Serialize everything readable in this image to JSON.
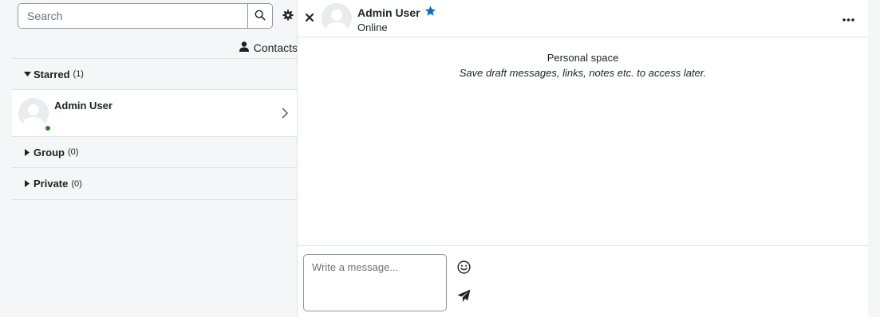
{
  "search": {
    "placeholder": "Search"
  },
  "contacts_link": {
    "label": "Contacts"
  },
  "sections": {
    "starred": {
      "title": "Starred",
      "count": "(1)",
      "expanded": true
    },
    "group": {
      "title": "Group",
      "count": "(0)",
      "expanded": false
    },
    "private": {
      "title": "Private",
      "count": "(0)",
      "expanded": false
    }
  },
  "starred_contacts": [
    {
      "name": "Admin User",
      "status": "online"
    }
  ],
  "conversation": {
    "name": "Admin User",
    "status": "Online",
    "starred": true,
    "personal_space_title": "Personal space",
    "personal_space_subtitle": "Save draft messages, links, notes etc. to access later."
  },
  "composer": {
    "placeholder": "Write a message..."
  },
  "icons": {
    "search": "search-icon",
    "settings": "gear-icon",
    "contacts": "user-icon",
    "close": "close-icon",
    "star": "star-icon",
    "more": "ellipsis-icon",
    "emoji": "smile-icon",
    "send": "paper-plane-icon"
  },
  "colors": {
    "online": "#357a32",
    "star": "#0f6cbf",
    "panel_bg": "#f5f6f7",
    "border": "#dee2e6"
  }
}
